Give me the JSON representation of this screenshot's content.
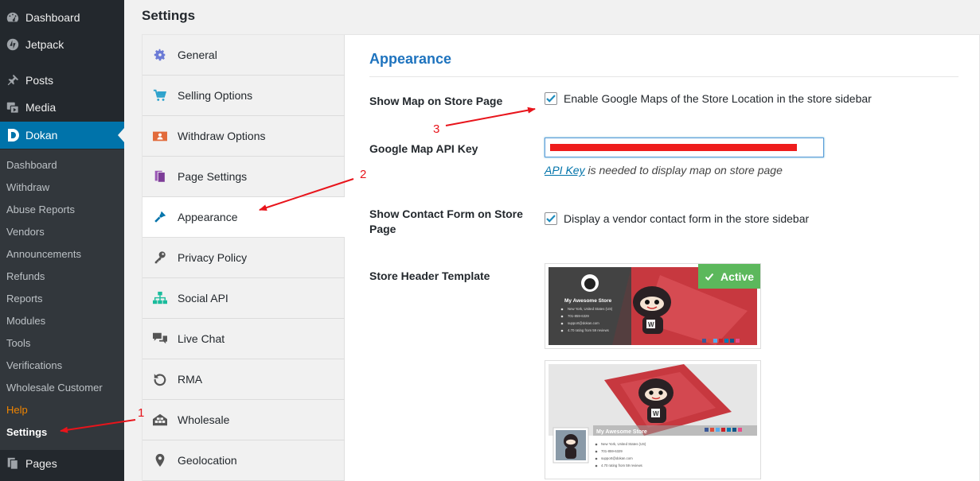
{
  "sidebar": {
    "top_items": [
      {
        "label": "Dashboard",
        "icon": "dashboard-icon"
      },
      {
        "label": "Jetpack",
        "icon": "jetpack-icon"
      },
      {
        "label": "Posts",
        "icon": "pin-icon"
      },
      {
        "label": "Media",
        "icon": "media-icon"
      },
      {
        "label": "Dokan",
        "icon": "dokan-logo-icon"
      }
    ],
    "dokan_submenu": [
      "Dashboard",
      "Withdraw",
      "Abuse Reports",
      "Vendors",
      "Announcements",
      "Refunds",
      "Reports",
      "Modules",
      "Tools",
      "Verifications",
      "Wholesale Customer",
      "Help",
      "Settings"
    ],
    "bottom_item": {
      "label": "Pages",
      "icon": "pages-icon"
    }
  },
  "page": {
    "title": "Settings"
  },
  "tabs": [
    {
      "label": "General",
      "icon": "gear-icon"
    },
    {
      "label": "Selling Options",
      "icon": "cart-icon"
    },
    {
      "label": "Withdraw Options",
      "icon": "withdraw-icon"
    },
    {
      "label": "Page Settings",
      "icon": "pages-icon"
    },
    {
      "label": "Appearance",
      "icon": "brush-icon"
    },
    {
      "label": "Privacy Policy",
      "icon": "key-icon"
    },
    {
      "label": "Social API",
      "icon": "network-icon"
    },
    {
      "label": "Live Chat",
      "icon": "chat-icon"
    },
    {
      "label": "RMA",
      "icon": "undo-icon"
    },
    {
      "label": "Wholesale",
      "icon": "wholesale-icon"
    },
    {
      "label": "Geolocation",
      "icon": "location-pin-icon"
    }
  ],
  "active_tab": "Appearance",
  "appearance": {
    "heading": "Appearance",
    "show_map_label": "Show Map on Store Page",
    "show_map_checkbox_label": "Enable Google Maps of the Store Location in the store sidebar",
    "api_key_label": "Google Map API Key",
    "api_key_link": "API Key",
    "api_key_desc": " is needed to display map on store page",
    "contact_form_label": "Show Contact Form on Store Page",
    "contact_form_checkbox_label": "Display a vendor contact form in the store sidebar",
    "header_template_label": "Store Header Template",
    "active_badge": "Active",
    "store_name": "My Awesome Store",
    "store_address": "New York, United States (US)",
    "store_phone": "701-859-6329",
    "store_email": "support@dokan.com",
    "store_rating": "4.70 rating from 59 reviews"
  },
  "annotations": [
    "1",
    "2",
    "3"
  ],
  "colors": {
    "admin_bg": "#23282d",
    "submenu_bg": "#32373c",
    "accent": "#0073aa",
    "active_green": "#5cb85c",
    "annotation_red": "#e8141b",
    "help_orange": "#f18500"
  }
}
